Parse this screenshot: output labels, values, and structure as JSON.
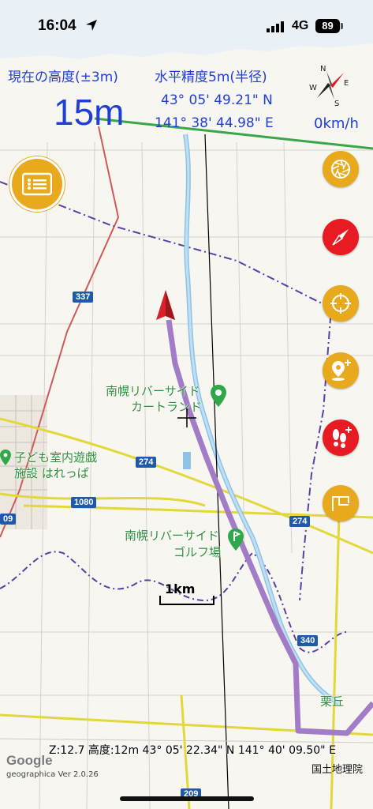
{
  "status": {
    "time": "16:04",
    "network": "4G",
    "battery": "89"
  },
  "hud": {
    "altitude_label": "現在の高度(±3m)",
    "altitude_value": "15m",
    "accuracy_label": "水平精度5m(半径)",
    "latitude": "43° 05' 49.21\" N",
    "longitude": "141° 38' 44.98\" E",
    "speed": "0km/h",
    "compass_letters": {
      "n": "N",
      "s": "S",
      "e": "E",
      "w": "W"
    }
  },
  "map": {
    "poi": [
      {
        "name": "南幌リバーサイド"
      },
      {
        "name": "カートランド"
      },
      {
        "name": "子ども室内遊戯"
      },
      {
        "name": "施設 はれっぱ"
      },
      {
        "name": "南幌リバーサイド"
      },
      {
        "name": "ゴルフ場"
      },
      {
        "name": "栗丘"
      }
    ],
    "roads": [
      "337",
      "274",
      "1080",
      "274",
      "340",
      "09",
      "209"
    ],
    "scale_label": "1km",
    "bottom_info": "Z:12.7 高度:12m  43° 05' 22.34\" N 141° 40' 09.50\" E",
    "google": "Google",
    "version": "geographica Ver 2.0.26",
    "attribution": "国土地理院"
  },
  "buttons": {
    "menu": "menu-icon",
    "right": [
      "layers-icon",
      "compass-icon",
      "target-icon",
      "add-pin-icon",
      "add-footprint-icon",
      "flag-icon"
    ]
  },
  "colors": {
    "accent_blue": "#1f3fd6",
    "button_yellow": "#e8a91c",
    "button_red": "#e81a22",
    "track_purple": "#a27cc6"
  }
}
